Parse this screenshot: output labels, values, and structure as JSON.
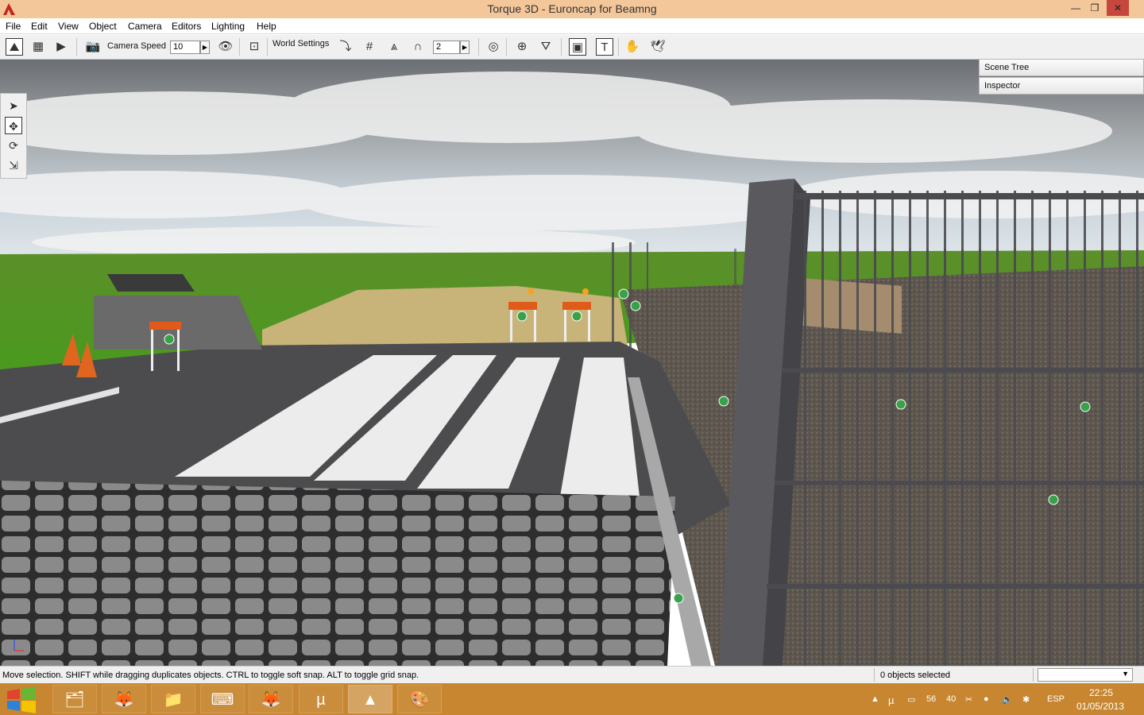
{
  "window": {
    "title": "Torque 3D - Euroncap for Beamng",
    "minimize_glyph": "—",
    "maximize_glyph": "❐",
    "close_glyph": "✕"
  },
  "menu": [
    "File",
    "Edit",
    "View",
    "Object",
    "Camera",
    "Editors",
    "Lighting",
    "Help"
  ],
  "toolbar": {
    "camera_speed_label": "Camera Speed",
    "camera_speed_value": "10",
    "world_settings_label": "World Settings",
    "grid_value": "2"
  },
  "panels": {
    "scene_tree": "Scene Tree",
    "inspector": "Inspector"
  },
  "status": {
    "hint": "Move selection.  SHIFT while dragging duplicates objects.  CTRL to toggle soft snap.  ALT to toggle grid snap.",
    "selection": "0 objects selected"
  },
  "taskbar": {
    "tray_numbers": [
      "56",
      "40"
    ],
    "language": "ESP",
    "time": "22:25",
    "date": "01/05/2013"
  },
  "colors": {
    "titlebar": "#f4c79a",
    "taskbar": "#c7862f",
    "close_button": "#c7463d"
  }
}
